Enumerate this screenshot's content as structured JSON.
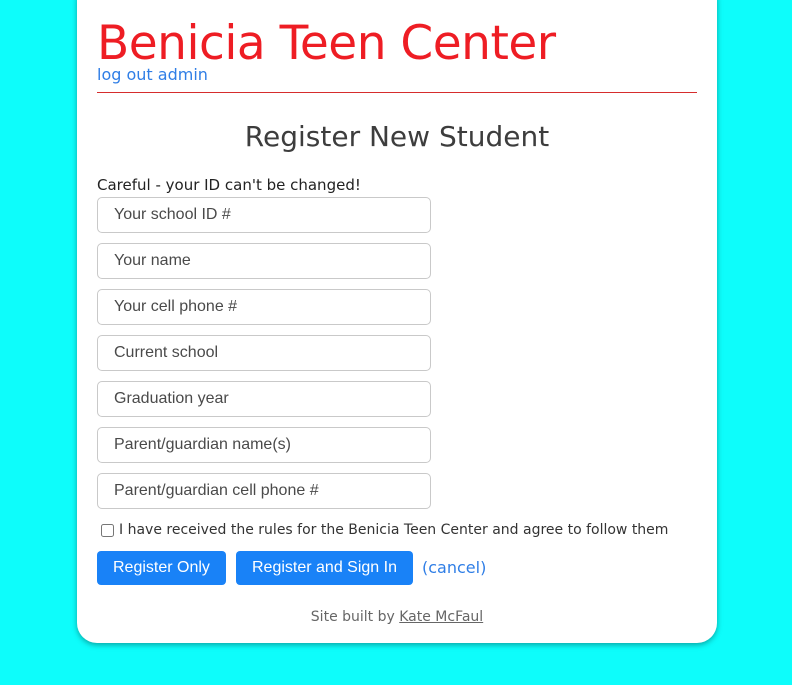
{
  "header": {
    "title": "Benicia Teen Center",
    "logout_link": "log out admin"
  },
  "form": {
    "heading": "Register New Student",
    "warning": "Careful - your ID can't be changed!",
    "fields": [
      {
        "placeholder": "Your school ID #",
        "value": ""
      },
      {
        "placeholder": "Your name",
        "value": ""
      },
      {
        "placeholder": "Your cell phone #",
        "value": ""
      },
      {
        "placeholder": "Current school",
        "value": ""
      },
      {
        "placeholder": "Graduation year",
        "value": ""
      },
      {
        "placeholder": "Parent/guardian name(s)",
        "value": ""
      },
      {
        "placeholder": "Parent/guardian cell phone #",
        "value": ""
      }
    ],
    "agree_label": "I have received the rules for the Benicia Teen Center and agree to follow them",
    "agree_checked": false,
    "register_only_label": "Register Only",
    "register_signin_label": "Register and Sign In",
    "cancel_label": "(cancel)"
  },
  "footer": {
    "prefix": "Site built by",
    "author": "Kate McFaul"
  },
  "colors": {
    "background": "#0dfdfb",
    "title": "#ee1d24",
    "link": "#2f7ee6",
    "button": "#1982f7"
  }
}
